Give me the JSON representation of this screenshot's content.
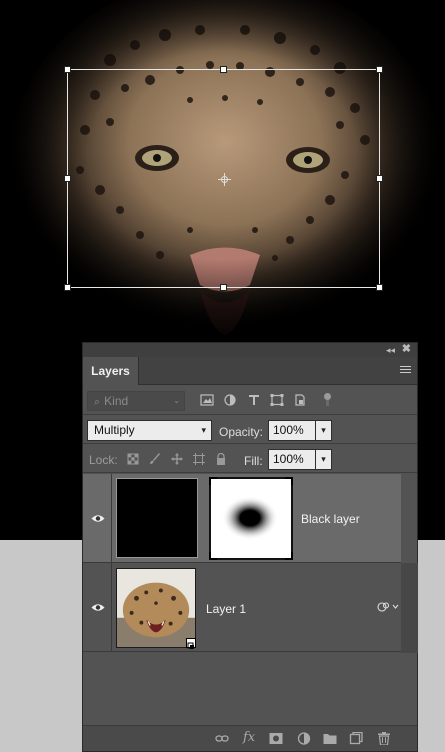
{
  "panel": {
    "title": "Layers",
    "collapse_glyph": "◂◂",
    "close_glyph": "✖",
    "filter": {
      "kind_placeholder": "Kind",
      "icons": [
        "pixel-filter-icon",
        "adjustment-filter-icon",
        "type-filter-icon",
        "shape-filter-icon",
        "smart-object-filter-icon"
      ]
    },
    "blend_mode": "Multiply",
    "opacity_label": "Opacity:",
    "opacity_value": "100%",
    "lock_label": "Lock:",
    "lock_icons": [
      "lock-transparent-pixels-icon",
      "lock-image-pixels-icon",
      "lock-position-icon",
      "lock-artboard-icon",
      "lock-all-icon"
    ],
    "fill_label": "Fill:",
    "fill_value": "100%",
    "layers": [
      {
        "name": "Black layer",
        "visible": true,
        "selected": true,
        "has_mask": true
      },
      {
        "name": "Layer 1",
        "visible": true,
        "selected": false,
        "smart_object": true
      }
    ],
    "bottom_icons": [
      "link-layers-icon",
      "fx-icon",
      "add-mask-icon",
      "adjustment-layer-icon",
      "new-group-icon",
      "new-layer-icon",
      "trash-icon"
    ],
    "fx_label": "fx"
  },
  "colors": {
    "panel_bg": "#535353",
    "selected_row": "#6a6a6a",
    "canvas_bg": "#000000",
    "pasteboard": "#c8c8c8"
  }
}
